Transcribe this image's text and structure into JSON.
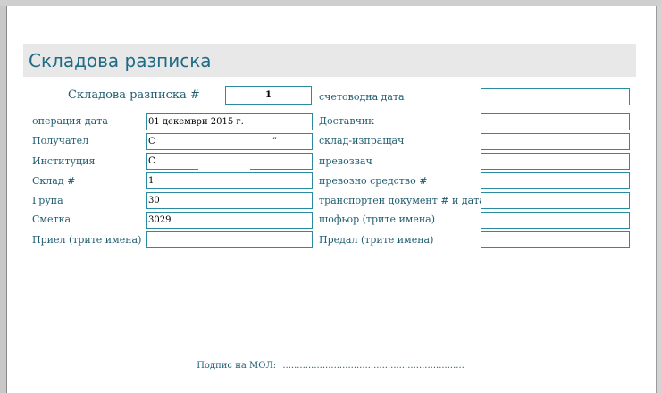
{
  "form": {
    "title": "Складова разписка",
    "receipt_label": "Складова разписка #",
    "receipt_number": "1",
    "accounting_date_label": "счетоводна дата",
    "accounting_date_value": ""
  },
  "left_fields": [
    {
      "label": "операция дата",
      "value": "01 декември 2015 г."
    },
    {
      "label": "Получател",
      "value": "С",
      "suffix": "”"
    },
    {
      "label": "Институция",
      "value": "С"
    },
    {
      "label": "Склад #",
      "value": "1"
    },
    {
      "label": "Група",
      "value": "30"
    },
    {
      "label": "Сметка",
      "value": "3029"
    },
    {
      "label": "Приел (трите имена)",
      "value": ""
    }
  ],
  "right_fields": [
    {
      "label": "Доставчик",
      "value": ""
    },
    {
      "label": "склад-изпращач",
      "value": ""
    },
    {
      "label": "превозвач",
      "value": ""
    },
    {
      "label": "превозно средство #",
      "value": ""
    },
    {
      "label": "транспортен документ # и дата",
      "value": ""
    },
    {
      "label": "шофьор (трите имена)",
      "value": ""
    },
    {
      "label": "Предал (трите имена)",
      "value": ""
    }
  ],
  "signature": {
    "label": "Подпис на МОЛ:",
    "line": "................................................................"
  }
}
